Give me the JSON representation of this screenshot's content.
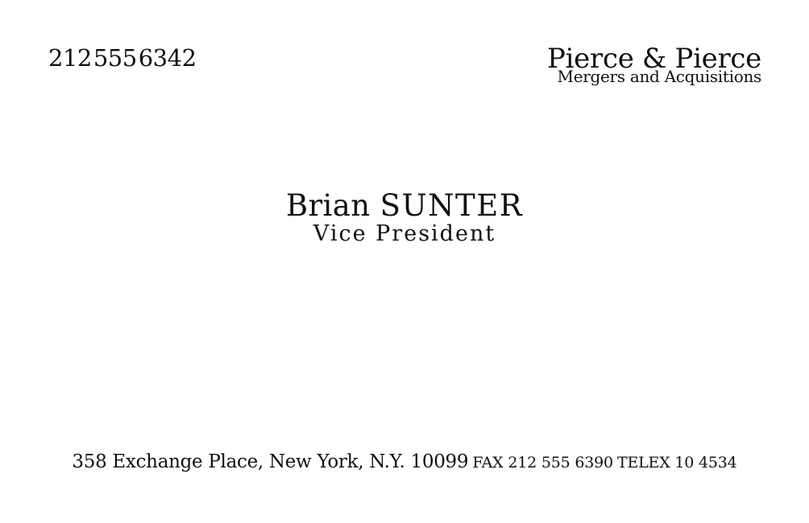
{
  "card": {
    "phone": {
      "area": "212",
      "exchange": "555",
      "line": "6342"
    },
    "company": {
      "name": "Pierce & Pierce",
      "tagline": "Mergers and Acquisitions"
    },
    "person": {
      "first_name": "Brian",
      "last_name": "SUNTER",
      "title": "Vice President"
    },
    "footer": {
      "address": "358 Exchange Place, New York, N.Y. 10099",
      "fax": "FAX 212 555 6390",
      "telex": "TELEX 10 4534"
    }
  }
}
